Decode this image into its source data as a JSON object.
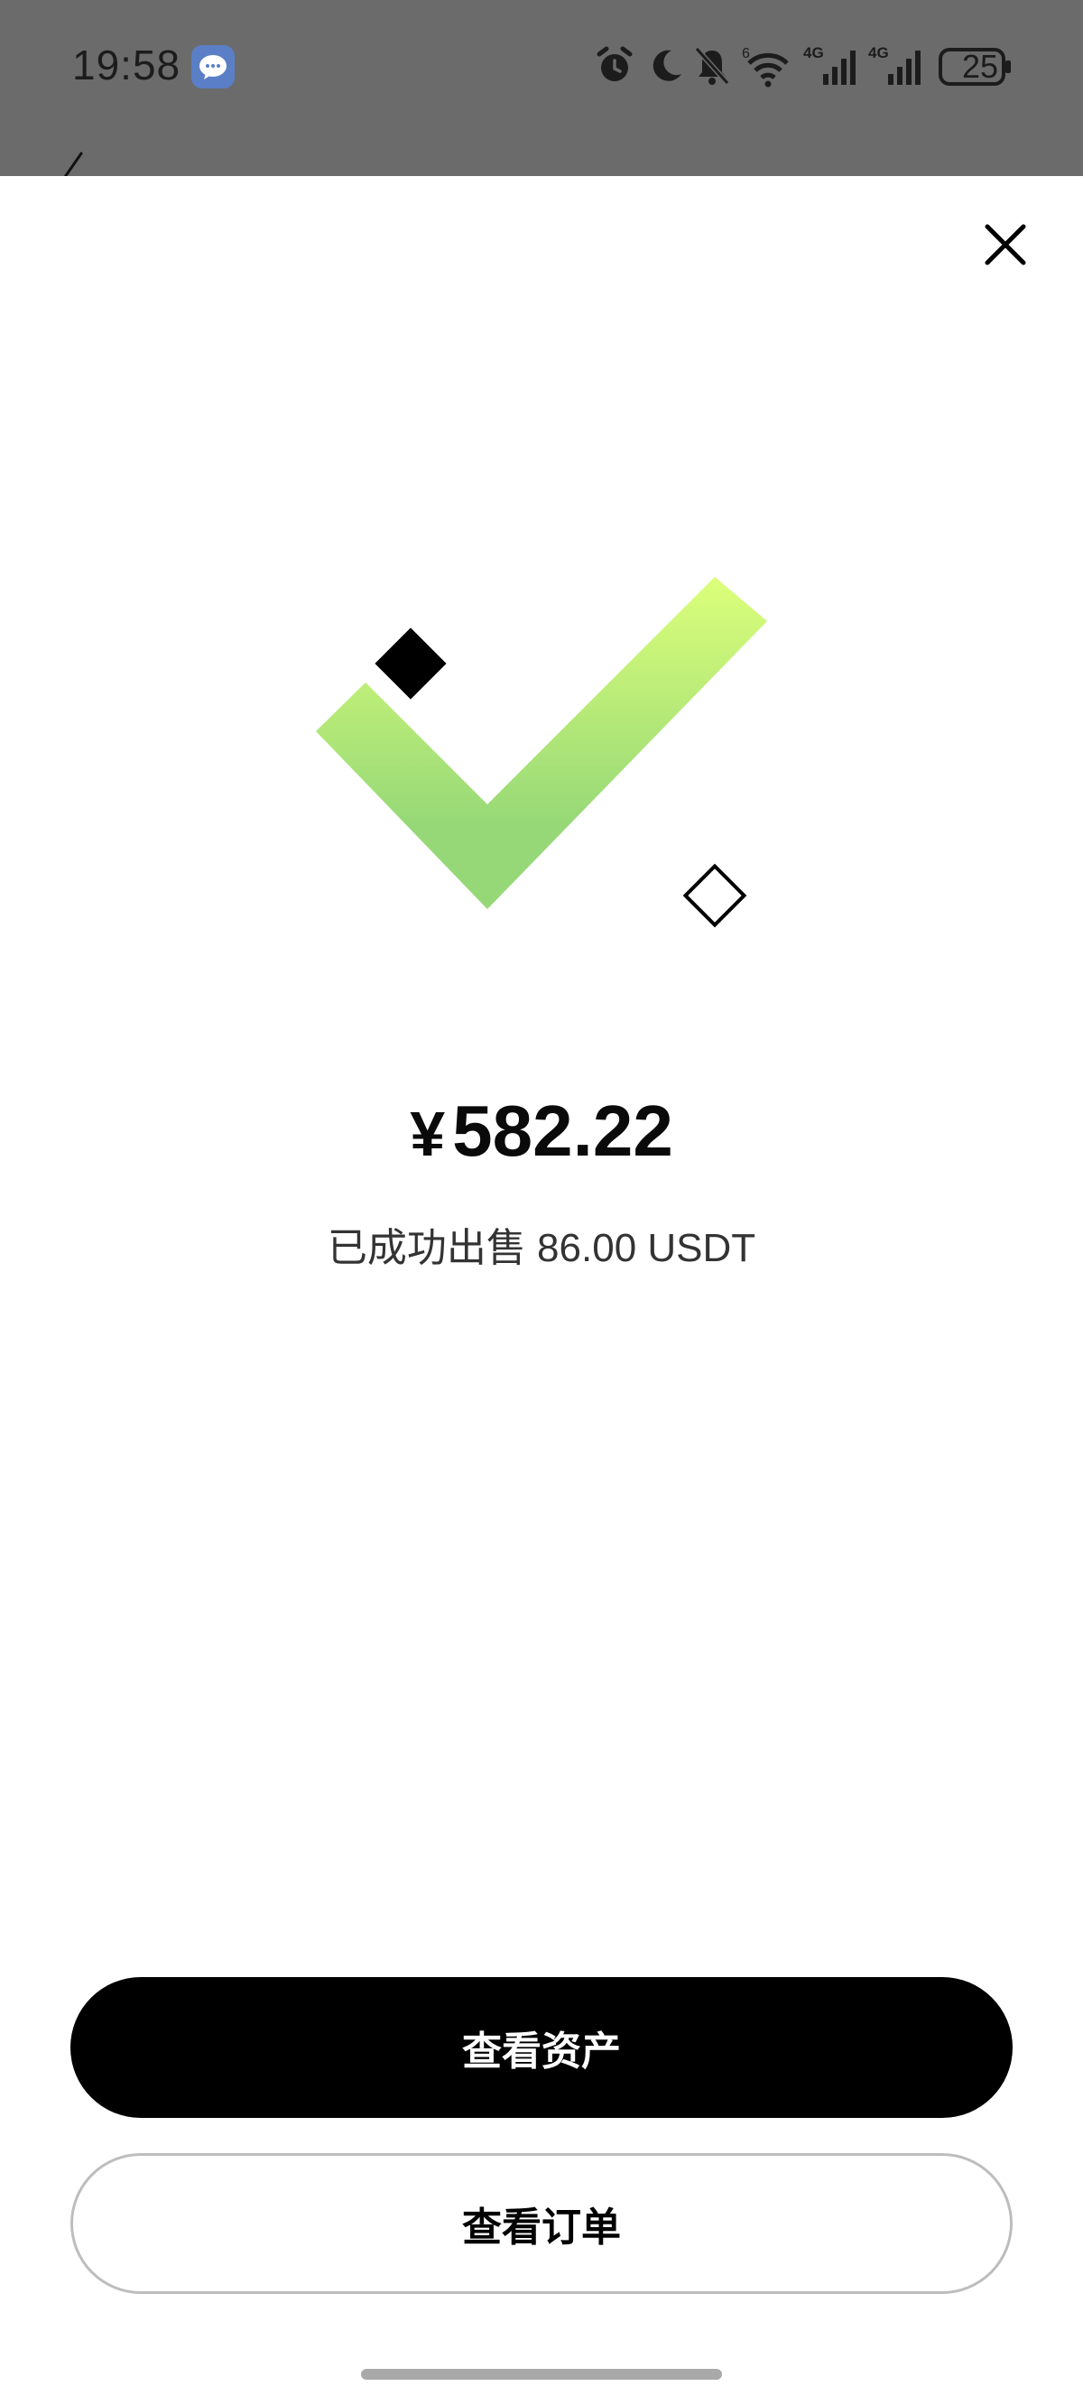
{
  "status_bar": {
    "time": "19:58",
    "battery": "25",
    "icons": [
      "alarm-icon",
      "moon-icon",
      "bell-off-icon",
      "wifi-icon",
      "signal-4g-icon",
      "signal-4g-icon",
      "battery-icon"
    ],
    "network_labels": [
      "4G",
      "4G"
    ],
    "wifi_label": "6"
  },
  "result": {
    "currency_symbol": "¥",
    "amount": "582.22",
    "message": "已成功出售 86.00 USDT"
  },
  "actions": {
    "view_assets": "查看资产",
    "view_orders": "查看订单"
  },
  "colors": {
    "check_top": "#dcff7a",
    "check_bottom": "#96d877",
    "primary_button": "#000000",
    "status_overlay": "#6b6b6b"
  }
}
